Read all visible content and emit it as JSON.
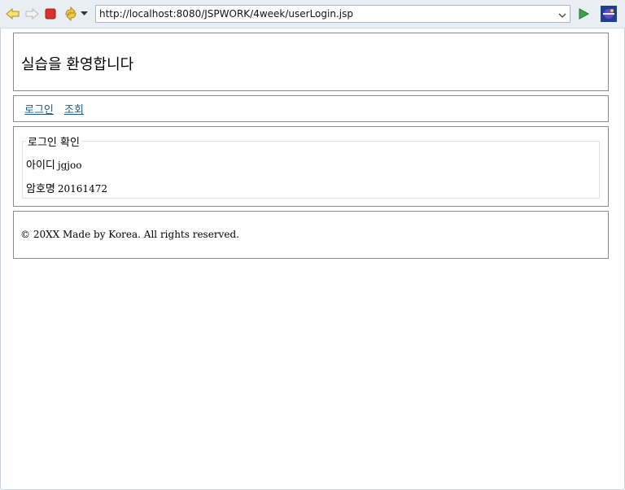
{
  "browser": {
    "url": "http://localhost:8080/JSPWORK/4week/userLogin.jsp",
    "toolbar_icons": [
      "back-arrow-icon",
      "forward-arrow-icon",
      "stop-icon",
      "refresh-icon",
      "dropdown-arrow-icon",
      "go-icon",
      "eclipse-icon"
    ],
    "colors": {
      "toolbar_bg": "#e9eef5",
      "stop_red": "#d9322b",
      "go_green": "#3aa34a",
      "link": "#1a5a8c"
    }
  },
  "header": {
    "title": "실습을 환영합니다"
  },
  "nav": {
    "items": [
      {
        "label": "로그인"
      },
      {
        "label": "조회"
      }
    ]
  },
  "login_check": {
    "legend": "로그인 확인",
    "fields": [
      {
        "label": "아이디",
        "value": "jgjoo"
      },
      {
        "label": "암호명",
        "value": "20161472"
      }
    ]
  },
  "footer": {
    "text": "© 20XX Made by Korea. All rights reserved."
  }
}
